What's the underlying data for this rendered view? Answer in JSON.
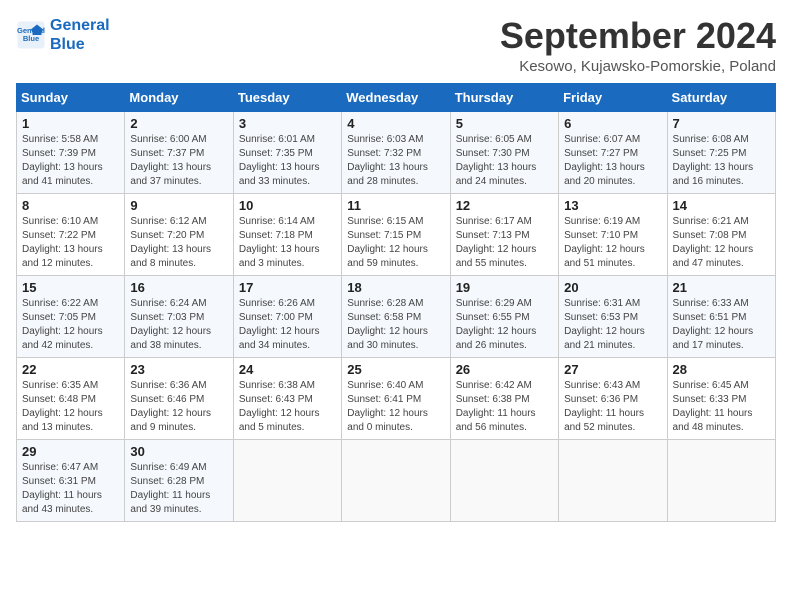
{
  "logo": {
    "line1": "General",
    "line2": "Blue"
  },
  "title": "September 2024",
  "location": "Kesowo, Kujawsko-Pomorskie, Poland",
  "days_of_week": [
    "Sunday",
    "Monday",
    "Tuesday",
    "Wednesday",
    "Thursday",
    "Friday",
    "Saturday"
  ],
  "weeks": [
    [
      {
        "day": 1,
        "info": "Sunrise: 5:58 AM\nSunset: 7:39 PM\nDaylight: 13 hours\nand 41 minutes."
      },
      {
        "day": 2,
        "info": "Sunrise: 6:00 AM\nSunset: 7:37 PM\nDaylight: 13 hours\nand 37 minutes."
      },
      {
        "day": 3,
        "info": "Sunrise: 6:01 AM\nSunset: 7:35 PM\nDaylight: 13 hours\nand 33 minutes."
      },
      {
        "day": 4,
        "info": "Sunrise: 6:03 AM\nSunset: 7:32 PM\nDaylight: 13 hours\nand 28 minutes."
      },
      {
        "day": 5,
        "info": "Sunrise: 6:05 AM\nSunset: 7:30 PM\nDaylight: 13 hours\nand 24 minutes."
      },
      {
        "day": 6,
        "info": "Sunrise: 6:07 AM\nSunset: 7:27 PM\nDaylight: 13 hours\nand 20 minutes."
      },
      {
        "day": 7,
        "info": "Sunrise: 6:08 AM\nSunset: 7:25 PM\nDaylight: 13 hours\nand 16 minutes."
      }
    ],
    [
      {
        "day": 8,
        "info": "Sunrise: 6:10 AM\nSunset: 7:22 PM\nDaylight: 13 hours\nand 12 minutes."
      },
      {
        "day": 9,
        "info": "Sunrise: 6:12 AM\nSunset: 7:20 PM\nDaylight: 13 hours\nand 8 minutes."
      },
      {
        "day": 10,
        "info": "Sunrise: 6:14 AM\nSunset: 7:18 PM\nDaylight: 13 hours\nand 3 minutes."
      },
      {
        "day": 11,
        "info": "Sunrise: 6:15 AM\nSunset: 7:15 PM\nDaylight: 12 hours\nand 59 minutes."
      },
      {
        "day": 12,
        "info": "Sunrise: 6:17 AM\nSunset: 7:13 PM\nDaylight: 12 hours\nand 55 minutes."
      },
      {
        "day": 13,
        "info": "Sunrise: 6:19 AM\nSunset: 7:10 PM\nDaylight: 12 hours\nand 51 minutes."
      },
      {
        "day": 14,
        "info": "Sunrise: 6:21 AM\nSunset: 7:08 PM\nDaylight: 12 hours\nand 47 minutes."
      }
    ],
    [
      {
        "day": 15,
        "info": "Sunrise: 6:22 AM\nSunset: 7:05 PM\nDaylight: 12 hours\nand 42 minutes."
      },
      {
        "day": 16,
        "info": "Sunrise: 6:24 AM\nSunset: 7:03 PM\nDaylight: 12 hours\nand 38 minutes."
      },
      {
        "day": 17,
        "info": "Sunrise: 6:26 AM\nSunset: 7:00 PM\nDaylight: 12 hours\nand 34 minutes."
      },
      {
        "day": 18,
        "info": "Sunrise: 6:28 AM\nSunset: 6:58 PM\nDaylight: 12 hours\nand 30 minutes."
      },
      {
        "day": 19,
        "info": "Sunrise: 6:29 AM\nSunset: 6:55 PM\nDaylight: 12 hours\nand 26 minutes."
      },
      {
        "day": 20,
        "info": "Sunrise: 6:31 AM\nSunset: 6:53 PM\nDaylight: 12 hours\nand 21 minutes."
      },
      {
        "day": 21,
        "info": "Sunrise: 6:33 AM\nSunset: 6:51 PM\nDaylight: 12 hours\nand 17 minutes."
      }
    ],
    [
      {
        "day": 22,
        "info": "Sunrise: 6:35 AM\nSunset: 6:48 PM\nDaylight: 12 hours\nand 13 minutes."
      },
      {
        "day": 23,
        "info": "Sunrise: 6:36 AM\nSunset: 6:46 PM\nDaylight: 12 hours\nand 9 minutes."
      },
      {
        "day": 24,
        "info": "Sunrise: 6:38 AM\nSunset: 6:43 PM\nDaylight: 12 hours\nand 5 minutes."
      },
      {
        "day": 25,
        "info": "Sunrise: 6:40 AM\nSunset: 6:41 PM\nDaylight: 12 hours\nand 0 minutes."
      },
      {
        "day": 26,
        "info": "Sunrise: 6:42 AM\nSunset: 6:38 PM\nDaylight: 11 hours\nand 56 minutes."
      },
      {
        "day": 27,
        "info": "Sunrise: 6:43 AM\nSunset: 6:36 PM\nDaylight: 11 hours\nand 52 minutes."
      },
      {
        "day": 28,
        "info": "Sunrise: 6:45 AM\nSunset: 6:33 PM\nDaylight: 11 hours\nand 48 minutes."
      }
    ],
    [
      {
        "day": 29,
        "info": "Sunrise: 6:47 AM\nSunset: 6:31 PM\nDaylight: 11 hours\nand 43 minutes."
      },
      {
        "day": 30,
        "info": "Sunrise: 6:49 AM\nSunset: 6:28 PM\nDaylight: 11 hours\nand 39 minutes."
      },
      null,
      null,
      null,
      null,
      null
    ]
  ]
}
